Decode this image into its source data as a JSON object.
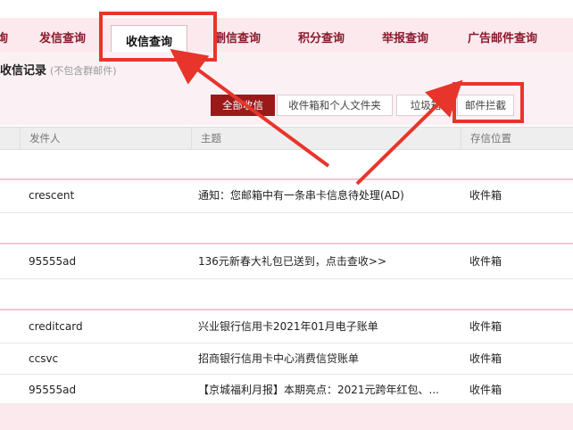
{
  "tabs": [
    {
      "label": "询",
      "active": false
    },
    {
      "label": "发信查询",
      "active": false
    },
    {
      "label": "收信查询",
      "active": true
    },
    {
      "label": "删信查询",
      "active": false
    },
    {
      "label": "积分查询",
      "active": false
    },
    {
      "label": "举报查询",
      "active": false
    },
    {
      "label": "广告邮件查询",
      "active": false
    }
  ],
  "section": {
    "title": "收信记录",
    "subtitle": "(不包含群邮件)"
  },
  "filters": [
    {
      "label": "全部收信",
      "active": true
    },
    {
      "label": "收件箱和个人文件夹",
      "active": false
    },
    {
      "label": "垃圾箱",
      "active": false
    },
    {
      "label": "邮件拦截",
      "active": false
    }
  ],
  "table": {
    "headers": [
      "发件人",
      "主题",
      "存信位置"
    ],
    "rows": [
      {
        "sender": "crescent",
        "subject": "通知：您邮箱中有一条串卡信息待处理(AD)",
        "location": "收件箱"
      },
      {
        "sender": "95555ad",
        "subject": "136元新春大礼包已送到，点击查收>>",
        "location": "收件箱"
      },
      {
        "sender": "creditcard",
        "subject": "兴业银行信用卡2021年01月电子账单",
        "location": "收件箱"
      },
      {
        "sender": "ccsvc",
        "subject": "招商银行信用卡中心消费信贷账单",
        "location": "收件箱"
      },
      {
        "sender": "95555ad",
        "subject": "【京城福利月报】本期亮点：2021元跨年红包、...",
        "location": "收件箱"
      }
    ]
  },
  "colors": {
    "annotation": "#e8352b",
    "accent": "#9a1a1a",
    "tab_text": "#8a1a2c",
    "tab_bar": "#fbe9ee"
  }
}
